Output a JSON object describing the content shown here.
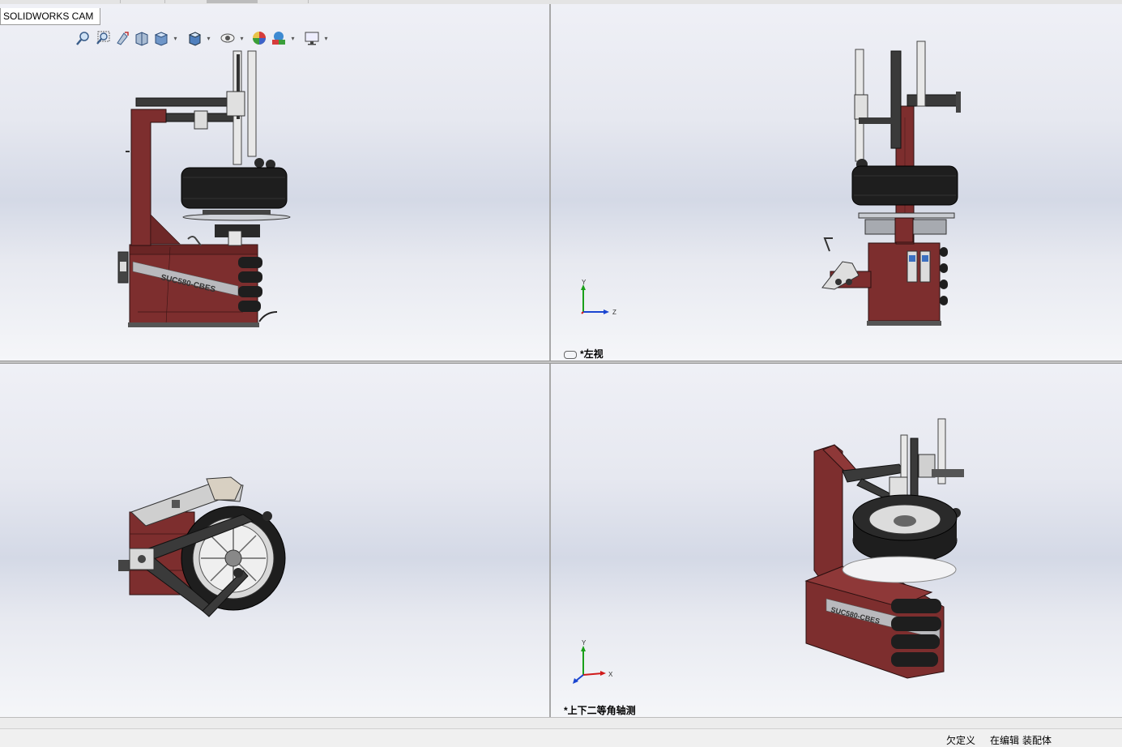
{
  "app": {
    "cam_tab_label": "SOLIDWORKS CAM"
  },
  "toolbar": {
    "items": [
      {
        "name": "zoom-to-fit-icon",
        "dropdown": false
      },
      {
        "name": "zoom-to-area-icon",
        "dropdown": false
      },
      {
        "name": "previous-view-icon",
        "dropdown": false
      },
      {
        "name": "section-view-icon",
        "dropdown": false
      },
      {
        "name": "view-orientation-icon",
        "dropdown": true
      },
      {
        "name": "display-style-icon",
        "dropdown": true
      },
      {
        "name": "hide-show-items-icon",
        "dropdown": true
      },
      {
        "name": "edit-appearance-icon",
        "dropdown": false
      },
      {
        "name": "apply-scene-icon",
        "dropdown": true
      },
      {
        "name": "view-settings-icon",
        "dropdown": true
      }
    ]
  },
  "viewports": {
    "front": {
      "label": ""
    },
    "left": {
      "label": "*左视",
      "triad_axes": [
        "Y",
        "Z"
      ]
    },
    "top": {
      "label": ""
    },
    "iso": {
      "label": "*上下二等角轴测",
      "triad_axes": [
        "Y",
        "X"
      ]
    }
  },
  "model": {
    "decal_text": "SUC580-CBES"
  },
  "colors": {
    "body": "#7d2e2e",
    "body_dark": "#5e2020",
    "tire": "#1e1e1e",
    "axis_y": "#1aa01a",
    "axis_z": "#1a45d0",
    "axis_x": "#d01a1a"
  },
  "status": {
    "underdefined": "欠定义",
    "editing": "在编辑",
    "assembly": "装配体"
  }
}
